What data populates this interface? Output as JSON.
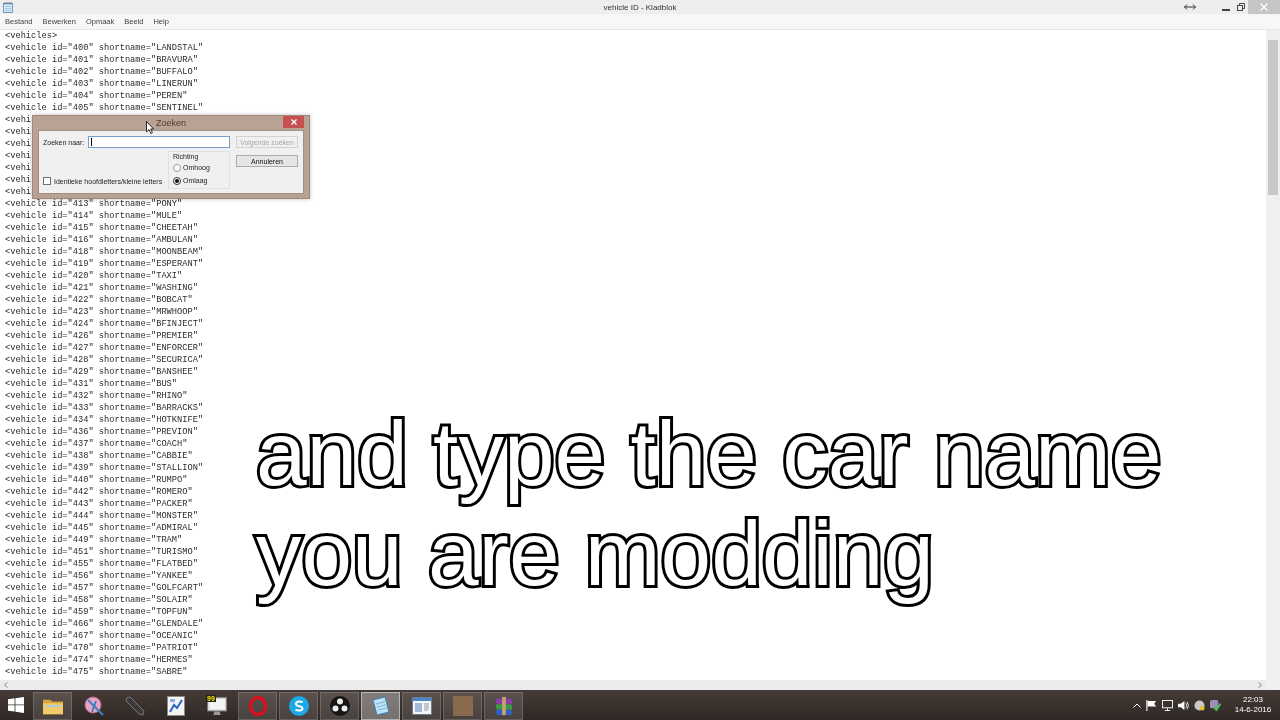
{
  "window": {
    "title": "vehicle ID - Kladblok"
  },
  "menu": [
    "Bestand",
    "Bewerken",
    "Opmaak",
    "Beeld",
    "Help"
  ],
  "editor": {
    "lines": [
      "<vehicles>",
      "<vehicle id=\"400\" shortname=\"LANDSTAL\"",
      "<vehicle id=\"401\" shortname=\"BRAVURA\"",
      "<vehicle id=\"402\" shortname=\"BUFFALO\"",
      "<vehicle id=\"403\" shortname=\"LINERUN\"",
      "<vehicle id=\"404\" shortname=\"PEREN\"",
      "<vehicle id=\"405\" shortname=\"SENTINEL\"",
      "<vehi",
      "<vehi",
      "<vehi",
      "<vehi",
      "<vehi",
      "<vehi",
      "<vehi",
      "<vehicle id=\"413\" shortname=\"PONY\"",
      "<vehicle id=\"414\" shortname=\"MULE\"",
      "<vehicle id=\"415\" shortname=\"CHEETAH\"",
      "<vehicle id=\"416\" shortname=\"AMBULAN\"",
      "<vehicle id=\"418\" shortname=\"MOONBEAM\"",
      "<vehicle id=\"419\" shortname=\"ESPERANT\"",
      "<vehicle id=\"420\" shortname=\"TAXI\"",
      "<vehicle id=\"421\" shortname=\"WASHING\"",
      "<vehicle id=\"422\" shortname=\"BOBCAT\"",
      "<vehicle id=\"423\" shortname=\"MRWHOOP\"",
      "<vehicle id=\"424\" shortname=\"BFINJECT\"",
      "<vehicle id=\"426\" shortname=\"PREMIER\"",
      "<vehicle id=\"427\" shortname=\"ENFORCER\"",
      "<vehicle id=\"428\" shortname=\"SECURICA\"",
      "<vehicle id=\"429\" shortname=\"BANSHEE\"",
      "<vehicle id=\"431\" shortname=\"BUS\"",
      "<vehicle id=\"432\" shortname=\"RHINO\"",
      "<vehicle id=\"433\" shortname=\"BARRACKS\"",
      "<vehicle id=\"434\" shortname=\"HOTKNIFE\"",
      "<vehicle id=\"436\" shortname=\"PREVION\"",
      "<vehicle id=\"437\" shortname=\"COACH\"",
      "<vehicle id=\"438\" shortname=\"CABBIE\"",
      "<vehicle id=\"439\" shortname=\"STALLION\"",
      "<vehicle id=\"440\" shortname=\"RUMPO\"",
      "<vehicle id=\"442\" shortname=\"ROMERO\"",
      "<vehicle id=\"443\" shortname=\"PACKER\"",
      "<vehicle id=\"444\" shortname=\"MONSTER\"",
      "<vehicle id=\"445\" shortname=\"ADMIRAL\"",
      "<vehicle id=\"449\" shortname=\"TRAM\"",
      "<vehicle id=\"451\" shortname=\"TURISMO\"",
      "<vehicle id=\"455\" shortname=\"FLATBED\"",
      "<vehicle id=\"456\" shortname=\"YANKEE\"",
      "<vehicle id=\"457\" shortname=\"GOLFCART\"",
      "<vehicle id=\"458\" shortname=\"SOLAIR\"",
      "<vehicle id=\"459\" shortname=\"TOPFUN\"",
      "<vehicle id=\"466\" shortname=\"GLENDALE\"",
      "<vehicle id=\"467\" shortname=\"OCEANIC\"",
      "<vehicle id=\"470\" shortname=\"PATRIOT\"",
      "<vehicle id=\"474\" shortname=\"HERMES\"",
      "<vehicle id=\"475\" shortname=\"SABRE\""
    ]
  },
  "find_dialog": {
    "title": "Zoeken",
    "search_label": "Zoeken naar:",
    "search_field": {
      "focused": true
    },
    "buttons": [
      {
        "label": "Volgende zoeken",
        "disabled": true
      },
      {
        "label": "Annuleren",
        "disabled": false
      }
    ],
    "direction": {
      "label": "Richting",
      "options": [
        {
          "label": "Omhoog",
          "selected": false
        },
        {
          "label": "Omlaag",
          "selected": true
        }
      ]
    },
    "match_case": {
      "label": "Identieke hoofdletters/kleine letters",
      "checked": false
    }
  },
  "caption": {
    "lines": [
      "and type the car name",
      "you are modding"
    ]
  },
  "taskbar": {
    "apps": [
      {
        "kind": "folder",
        "running": true,
        "selected": false
      },
      {
        "kind": "disc",
        "running": false,
        "selected": false
      },
      {
        "kind": "pen",
        "running": false,
        "selected": false
      },
      {
        "kind": "chart",
        "running": false,
        "selected": false
      },
      {
        "kind": "monitor",
        "badge": "99",
        "running": false,
        "selected": false
      },
      {
        "kind": "ring",
        "running": true,
        "selected": false
      },
      {
        "kind": "swirl",
        "running": true,
        "selected": false
      },
      {
        "kind": "dots",
        "running": true,
        "selected": false
      },
      {
        "kind": "notepad",
        "running": true,
        "selected": true
      },
      {
        "kind": "window",
        "running": true,
        "selected": false
      },
      {
        "kind": "picture",
        "running": true,
        "selected": false
      },
      {
        "kind": "books",
        "running": true,
        "selected": false
      }
    ],
    "clock": {
      "time": "22:03",
      "date": "14-6-2016"
    }
  }
}
